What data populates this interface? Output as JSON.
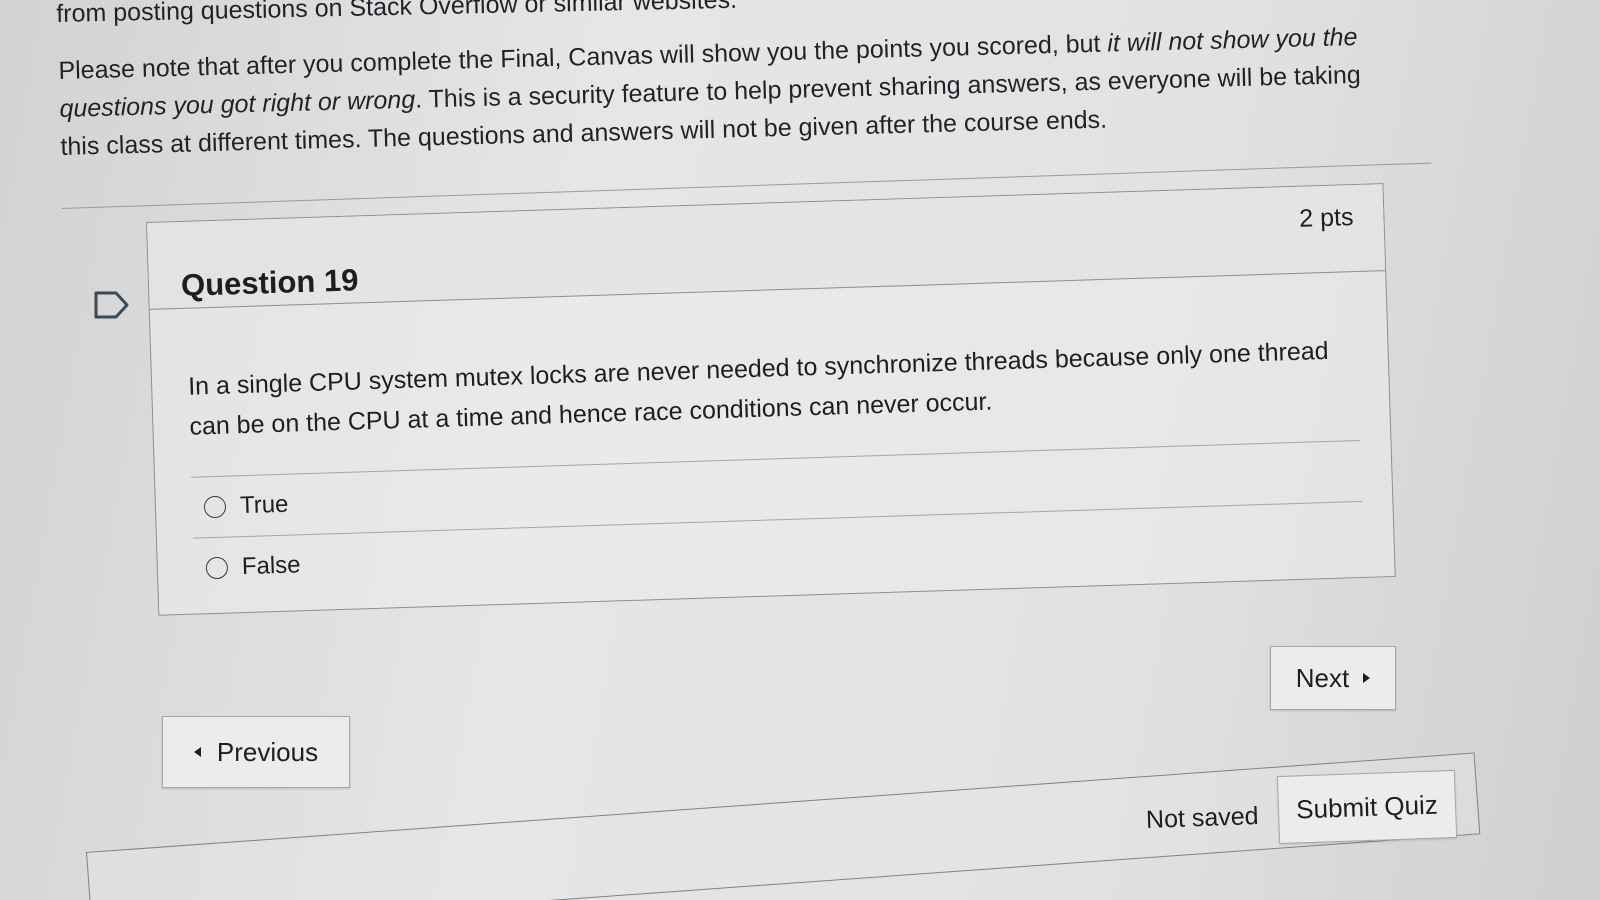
{
  "intro": {
    "top_line": "from posting questions on Stack Overflow or similar websites.",
    "note_part1": "Please note that after you complete the Final, Canvas will show you the points you scored, but ",
    "note_italic": "it will not show you the questions you got right or wrong",
    "note_part2": ". This is a security feature to help prevent sharing answers, as everyone will be taking this class at different times. The questions and answers will not be given after the course ends."
  },
  "question": {
    "title": "Question 19",
    "points": "2 pts",
    "text": "In a single CPU system mutex locks are never needed to synchronize threads because only one thread can be on the CPU at a time and hence race conditions can never occur.",
    "answers": [
      {
        "label": "True",
        "selected": false
      },
      {
        "label": "False",
        "selected": false
      }
    ]
  },
  "navigation": {
    "next_label": "Next",
    "previous_label": "Previous"
  },
  "footer": {
    "status": "Not saved",
    "submit_label": "Submit Quiz"
  }
}
